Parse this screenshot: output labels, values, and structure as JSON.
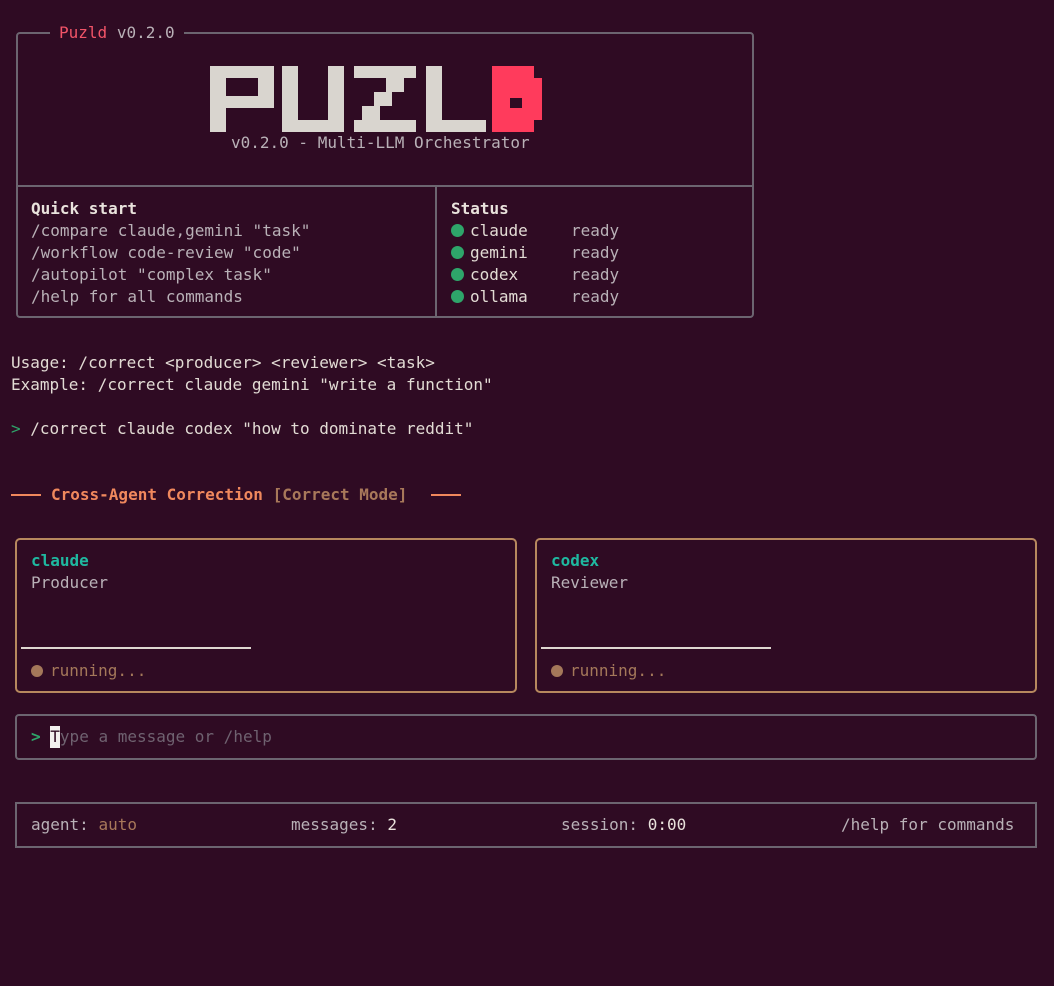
{
  "header": {
    "app_name": "Puzld",
    "version": "v0.2.0",
    "logo_text": "PUZLD",
    "subtitle": "v0.2.0 - Multi-LLM Orchestrator"
  },
  "quick_start": {
    "title": "Quick start",
    "items": [
      "/compare claude,gemini \"task\"",
      "/workflow code-review \"code\"",
      "/autopilot \"complex task\"",
      "/help for all commands"
    ]
  },
  "status": {
    "title": "Status",
    "agents": [
      {
        "name": "claude",
        "state": "ready"
      },
      {
        "name": "gemini",
        "state": "ready"
      },
      {
        "name": "codex",
        "state": "ready"
      },
      {
        "name": "ollama",
        "state": "ready"
      }
    ]
  },
  "output": {
    "usage": "Usage: /correct <producer> <reviewer> <task>",
    "example": "Example: /correct claude gemini \"write a function\"",
    "prompt_symbol": ">",
    "command": "/correct claude codex \"how to dominate reddit\""
  },
  "mode": {
    "title": "Cross-Agent Correction",
    "badge": "[Correct Mode]"
  },
  "cards": [
    {
      "agent": "claude",
      "role": "Producer",
      "status": "running..."
    },
    {
      "agent": "codex",
      "role": "Reviewer",
      "status": "running..."
    }
  ],
  "input": {
    "prompt_symbol": ">",
    "cursor_char": "T",
    "placeholder_rest": "ype a message or /help"
  },
  "status_bar": {
    "agent_label": "agent:",
    "agent_value": "auto",
    "messages_label": "messages:",
    "messages_value": "2",
    "session_label": "session:",
    "session_value": "0:00",
    "help": "/help for commands"
  },
  "colors": {
    "background": "#2f0b23",
    "accent_red": "#f25468",
    "ready_green": "#2ea56a",
    "orange": "#f0885d",
    "teal": "#1fb8a0",
    "card_border": "#b7885e"
  }
}
